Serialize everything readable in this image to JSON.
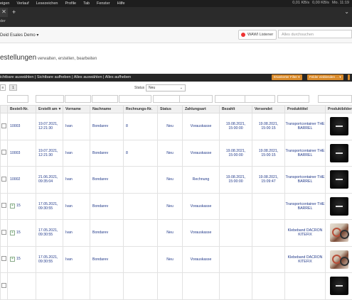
{
  "menubar": {
    "items": [
      "eigen",
      "Verlauf",
      "Lesezeichen",
      "Profile",
      "Tab",
      "Fenster",
      "Hilfe"
    ],
    "tray": [
      "0,01 KB/s",
      "0,00 KB/s",
      "Mo. 11:19"
    ]
  },
  "browser": {
    "new_tab": "+",
    "url_text": "der"
  },
  "app": {
    "shop_selector": "Deid Esales Demo",
    "wawi_label": "WAWI Listener",
    "search_placeholder": "Alles durchsuchen"
  },
  "page": {
    "title": "estellungen",
    "subtitle": "verwalten, erstellen, bearbeiten"
  },
  "actions": {
    "text": "ichtbare auswählen | Sichtbare aufheben | Alles auswählen | Alles aufheben",
    "filter_button": "Erweiterter Filter",
    "columns_button": "Felder einblenden ..."
  },
  "toolbar": {
    "page_number": "1",
    "status_label": "Status",
    "status_value": "Neu"
  },
  "table": {
    "columns": [
      "Bestell-Nr.",
      "Erstellt am",
      "Vorname",
      "Nachname",
      "Rechnungs-Nr.",
      "Status",
      "Zahlungsart",
      "Bezahlt",
      "Versendet",
      "Produkttitel",
      "Produktbilder"
    ],
    "rows": [
      {
        "order": "10003",
        "created": "19.07.2021, 12:21:30",
        "first": "Ivan",
        "last": "Bondarev",
        "invoice": "8",
        "status": "Neu",
        "payment": "Vorauskasse",
        "paid": "19.08.2021, 15:00:00",
        "shipped": "19.08.2021, 15:00:15",
        "product": "Transportcontainer THE BARREL",
        "image": "barrel"
      },
      {
        "order": "10003",
        "created": "19.07.2021, 12:21:30",
        "first": "Ivan",
        "last": "Bondarev",
        "invoice": "8",
        "status": "Neu",
        "payment": "Vorauskasse",
        "paid": "19.08.2021, 15:00:00",
        "shipped": "19.08.2021, 15:00:15",
        "product": "Transportcontainer THE BARREL",
        "image": "barrel"
      },
      {
        "order": "10002",
        "created": "21.06.2021, 09:35:04",
        "first": "Ivan",
        "last": "Bondarev",
        "invoice": "",
        "status": "Neu",
        "payment": "Rechnung",
        "paid": "19.08.2021, 15:00:00",
        "shipped": "19.08.2021, 15:09:47",
        "product": "Transportcontainer THE BARREL",
        "image": "barrel"
      },
      {
        "order": "15",
        "created": "17.05.2021, 09:30:55",
        "first": "Ivan",
        "last": "Bondarev",
        "invoice": "",
        "status": "Neu",
        "payment": "Vorauskasse",
        "paid": "",
        "shipped": "",
        "product": "Transportcontainer THE BARREL",
        "image": "barrel"
      },
      {
        "order": "15",
        "created": "17.05.2021, 09:30:55",
        "first": "Ivan",
        "last": "Bondarev",
        "invoice": "",
        "status": "Neu",
        "payment": "Vorauskasse",
        "paid": "",
        "shipped": "",
        "product": "Klebeband DACRON KITEFIX",
        "image": "tape"
      },
      {
        "order": "15",
        "created": "17.05.2021, 09:30:55",
        "first": "Ivan",
        "last": "Bondarev",
        "invoice": "",
        "status": "Neu",
        "payment": "Vorauskasse",
        "paid": "",
        "shipped": "",
        "product": "Klebeband DACRON KITEFIX",
        "image": "tape"
      },
      {
        "order": "",
        "created": "",
        "first": "",
        "last": "",
        "invoice": "",
        "status": "",
        "payment": "",
        "paid": "",
        "shipped": "",
        "product": "",
        "image": "barrel"
      }
    ]
  },
  "colors": {
    "accent_orange": "#d98a2a",
    "link_blue": "#223a8a",
    "dark_bar": "#262626"
  }
}
